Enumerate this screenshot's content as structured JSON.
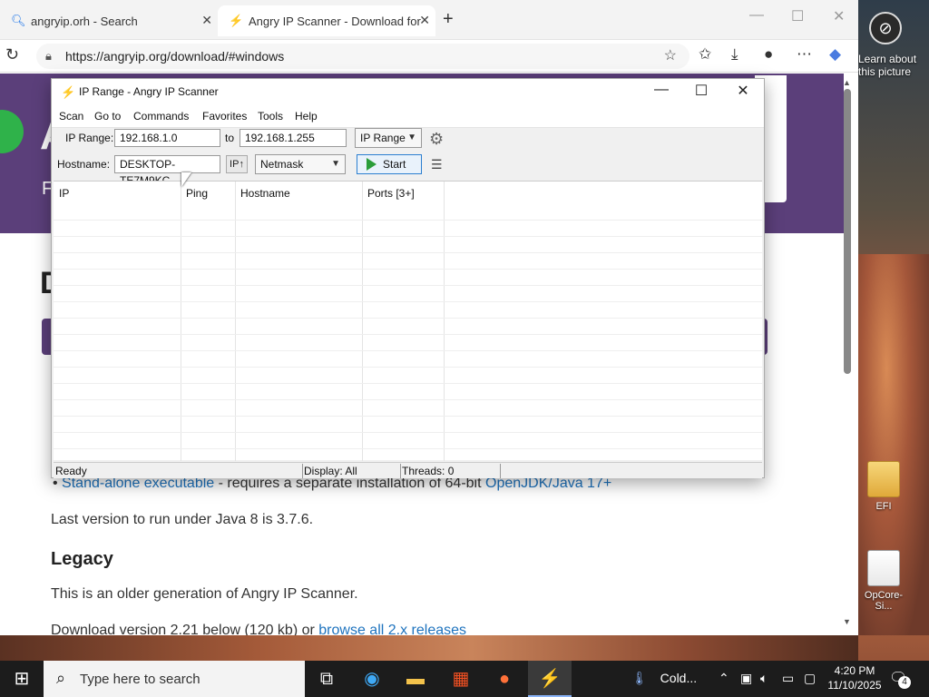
{
  "desktop": {
    "learn_about": "Learn about this picture",
    "icons": [
      "EFI",
      "OpCore-Si..."
    ]
  },
  "browser": {
    "tabs": [
      {
        "label": "angryip.orh - Search"
      },
      {
        "label": "Angry IP Scanner - Download for"
      }
    ],
    "url": "https://angryip.org/download/#windows"
  },
  "page": {
    "hero_letter": "A",
    "hero_sub": "F",
    "heading_d": "D",
    "bullet_link1": "Stand-alone executable",
    "bullet_text": " - requires a separate installation of 64-bit ",
    "bullet_link2": "OpenJDK/Java 17+",
    "java8": "Last version to run under Java 8 is 3.7.6.",
    "legacy_heading": "Legacy",
    "legacy_text": "This is an older generation of Angry IP Scanner.",
    "download_text": "Download version 2.21 below (120 kb) or ",
    "download_link": "browse all 2.x releases"
  },
  "scanner": {
    "title": "IP Range - Angry IP Scanner",
    "menu": [
      "Scan",
      "Go to",
      "Commands",
      "Favorites",
      "Tools",
      "Help"
    ],
    "ip_range_label": "IP Range:",
    "ip_from": "192.168.1.0",
    "to_label": "to",
    "ip_to": "192.168.1.255",
    "mode_select": "IP Range",
    "hostname_label": "Hostname:",
    "hostname_value": "DESKTOP-TE7M9KC",
    "ip_button": "IP↑",
    "netmask_select": "Netmask",
    "start_button": "Start",
    "columns": [
      "IP",
      "Ping",
      "Hostname",
      "Ports [3+]"
    ],
    "status": {
      "ready": "Ready",
      "display": "Display: All",
      "threads": "Threads: 0"
    }
  },
  "taskbar": {
    "search_placeholder": "Type here to search",
    "weather": "Cold...",
    "time": "4:20 PM",
    "date": "11/10/2025",
    "notifications": "4"
  }
}
